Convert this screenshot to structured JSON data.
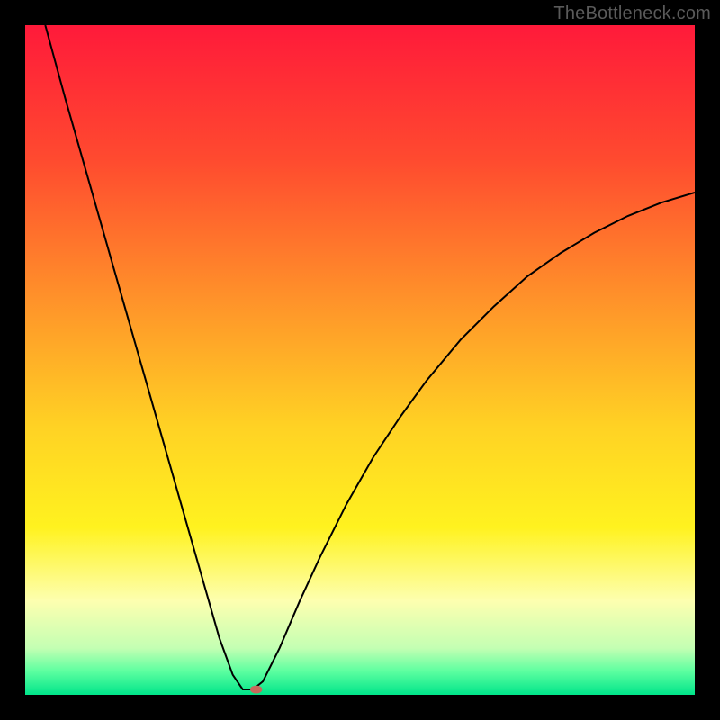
{
  "watermark": "TheBottleneck.com",
  "chart_data": {
    "type": "line",
    "title": "",
    "xlabel": "",
    "ylabel": "",
    "xlim": [
      0,
      100
    ],
    "ylim": [
      0,
      100
    ],
    "grid": false,
    "background_gradient": {
      "stops": [
        {
          "offset": 0.0,
          "color": "#ff1a3a"
        },
        {
          "offset": 0.2,
          "color": "#ff4a2f"
        },
        {
          "offset": 0.4,
          "color": "#ff8f2a"
        },
        {
          "offset": 0.6,
          "color": "#ffd224"
        },
        {
          "offset": 0.75,
          "color": "#fff21f"
        },
        {
          "offset": 0.86,
          "color": "#fdffb0"
        },
        {
          "offset": 0.93,
          "color": "#c4ffb3"
        },
        {
          "offset": 0.965,
          "color": "#5cffa0"
        },
        {
          "offset": 1.0,
          "color": "#00e58a"
        }
      ]
    },
    "series": [
      {
        "name": "bottleneck-curve",
        "color": "#000000",
        "points": [
          {
            "x": 3.0,
            "y": 100.0
          },
          {
            "x": 6.0,
            "y": 89.0
          },
          {
            "x": 9.0,
            "y": 78.5
          },
          {
            "x": 12.0,
            "y": 68.0
          },
          {
            "x": 15.0,
            "y": 57.5
          },
          {
            "x": 18.0,
            "y": 47.0
          },
          {
            "x": 21.0,
            "y": 36.5
          },
          {
            "x": 24.0,
            "y": 26.0
          },
          {
            "x": 27.0,
            "y": 15.5
          },
          {
            "x": 29.0,
            "y": 8.5
          },
          {
            "x": 31.0,
            "y": 3.0
          },
          {
            "x": 32.5,
            "y": 0.8
          },
          {
            "x": 34.0,
            "y": 0.8
          },
          {
            "x": 35.5,
            "y": 2.0
          },
          {
            "x": 38.0,
            "y": 7.0
          },
          {
            "x": 41.0,
            "y": 14.0
          },
          {
            "x": 44.0,
            "y": 20.5
          },
          {
            "x": 48.0,
            "y": 28.5
          },
          {
            "x": 52.0,
            "y": 35.5
          },
          {
            "x": 56.0,
            "y": 41.5
          },
          {
            "x": 60.0,
            "y": 47.0
          },
          {
            "x": 65.0,
            "y": 53.0
          },
          {
            "x": 70.0,
            "y": 58.0
          },
          {
            "x": 75.0,
            "y": 62.5
          },
          {
            "x": 80.0,
            "y": 66.0
          },
          {
            "x": 85.0,
            "y": 69.0
          },
          {
            "x": 90.0,
            "y": 71.5
          },
          {
            "x": 95.0,
            "y": 73.5
          },
          {
            "x": 100.0,
            "y": 75.0
          }
        ]
      }
    ],
    "marker": {
      "name": "bottleneck-minimum",
      "x": 34.5,
      "y": 0.8,
      "rx": 0.9,
      "ry": 0.6,
      "color": "#c76a5c"
    }
  }
}
